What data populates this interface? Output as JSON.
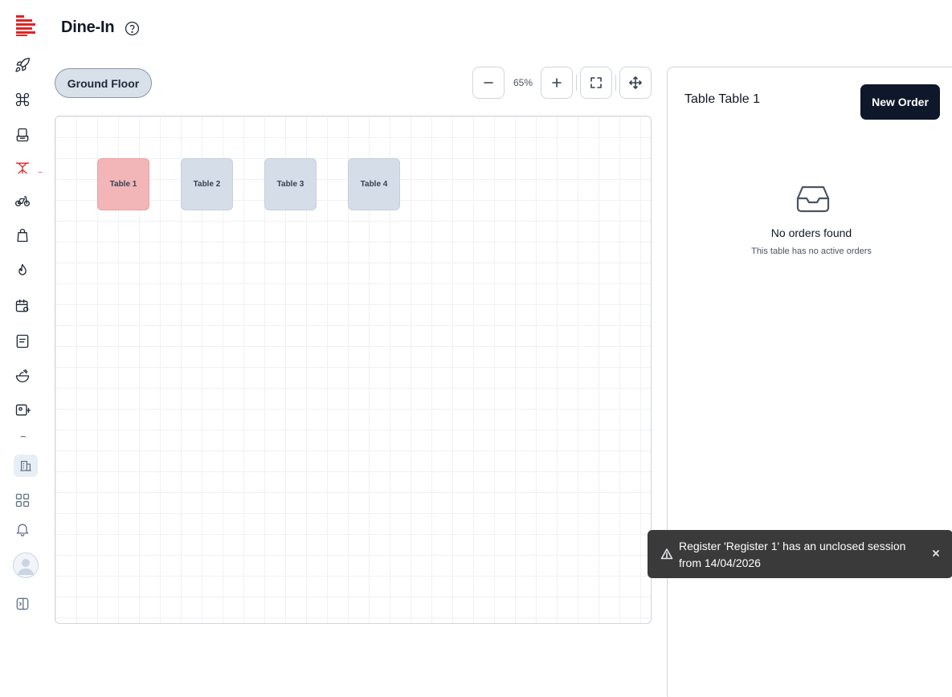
{
  "header": {
    "title": "Dine-In"
  },
  "sidebar": {
    "items": [
      {
        "icon": "rocket-icon",
        "label": "Launch"
      },
      {
        "icon": "command-icon",
        "label": "Commands"
      },
      {
        "icon": "pos-terminal-icon",
        "label": "POS"
      },
      {
        "icon": "dine-in-table-icon",
        "label": "Dine-In",
        "active": true,
        "badge": "..."
      },
      {
        "icon": "bike-icon",
        "label": "Delivery"
      },
      {
        "icon": "bag-icon",
        "label": "Takeaway"
      },
      {
        "icon": "fire-icon",
        "label": "Kitchen"
      },
      {
        "icon": "calendar-settings-icon",
        "label": "Reservations"
      },
      {
        "icon": "receipt-icon",
        "label": "Orders"
      },
      {
        "icon": "food-bowl-icon",
        "label": "Menu"
      },
      {
        "icon": "image-add-icon",
        "label": "Media"
      },
      {
        "icon": "building-icon",
        "label": "Branches"
      },
      {
        "icon": "grid-icon",
        "label": "Apps"
      },
      {
        "icon": "bell-icon",
        "label": "Notifications"
      },
      {
        "icon": "avatar-icon",
        "label": "Profile"
      },
      {
        "icon": "sidebar-toggle-icon",
        "label": "Toggle sidebar"
      }
    ],
    "active_badge": "..."
  },
  "floors": {
    "tabs": [
      {
        "label": "Ground Floor",
        "selected": true
      }
    ]
  },
  "zoom": {
    "level": "65%"
  },
  "tables": [
    {
      "label": "Table 1",
      "status": "occupied"
    },
    {
      "label": "Table 2",
      "status": "free"
    },
    {
      "label": "Table 3",
      "status": "free"
    },
    {
      "label": "Table 4",
      "status": "free"
    }
  ],
  "panel": {
    "title": "Table Table 1",
    "new_order_label": "New Order",
    "empty_title": "No orders found",
    "empty_subtitle": "This table has no active orders"
  },
  "toast": {
    "message": "Register 'Register 1' has an unclosed session from 14/04/2026"
  },
  "colors": {
    "brand": "#dc2626",
    "occupied": "#f2b6b8",
    "free": "#d5dde8",
    "primary_button": "#0f172a",
    "toast_bg": "#3a3a3a"
  }
}
